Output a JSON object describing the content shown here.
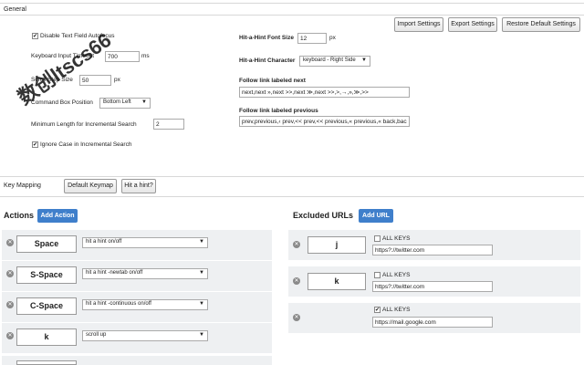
{
  "general": {
    "title": "General",
    "buttons": {
      "import": "Import Settings",
      "export": "Export Settings",
      "restore": "Restore Default Settings"
    },
    "disable_autofocus": {
      "label": "Disable Text Field Autofocus",
      "checked": true
    },
    "keyboard_timeout": {
      "label": "Keyboard Input Timeout",
      "value": "700",
      "unit": "ms"
    },
    "scroll_step": {
      "label": "Scroll Step Size",
      "value": "50",
      "unit": "px"
    },
    "command_box": {
      "label": "Command Box Position",
      "value": "Bottom Left"
    },
    "min_length": {
      "label": "Minimum Length for Incremental Search",
      "value": "2"
    },
    "ignore_case": {
      "label": "Ignore Case in Incremental Search",
      "checked": true
    },
    "hint_font_size": {
      "label": "Hit-a-Hint Font Size",
      "value": "12",
      "unit": "px"
    },
    "hint_character": {
      "label": "Hit-a-Hint Character",
      "value": "keyboard - Right Side"
    },
    "follow_next": {
      "label": "Follow link labeled next",
      "value": "next,next »,next >>,next ≫,next >>,>,→,»,≫,>>"
    },
    "follow_prev": {
      "label": "Follow link labeled previous",
      "value": "prev,previous,‹ prev,<< prev,<< previous,« previous,« back,bac"
    }
  },
  "key_mapping": {
    "title": "Key Mapping",
    "default_keymap": "Default Keymap",
    "hit_a_hint": "Hit a hint?"
  },
  "actions": {
    "title": "Actions",
    "add_label": "Add Action",
    "rows": [
      {
        "key": "Space",
        "action": "hit a hint on/off"
      },
      {
        "key": "S-Space",
        "action": "hit a hint -newtab on/off"
      },
      {
        "key": "C-Space",
        "action": "hit a hint -continuous on/off"
      },
      {
        "key": "k",
        "action": "scroll up"
      }
    ]
  },
  "excluded": {
    "title": "Excluded URLs",
    "add_label": "Add URL",
    "all_keys_label": "ALL KEYS",
    "rows": [
      {
        "key": "j",
        "all_keys": false,
        "url": "https?://twitter.com"
      },
      {
        "key": "k",
        "all_keys": false,
        "url": "https?://twitter.com"
      },
      {
        "key": "",
        "all_keys": true,
        "url": "https://mail.google.com"
      }
    ]
  },
  "watermark": "数创ltscs66",
  "colors": {
    "accent": "#3f7fcb",
    "row_bg": "#eef0f2",
    "divider": "#d8d8d8"
  },
  "icons": {
    "remove": "close-circle-icon",
    "dropdown": "caret-down-icon",
    "check": "checkmark-icon"
  }
}
